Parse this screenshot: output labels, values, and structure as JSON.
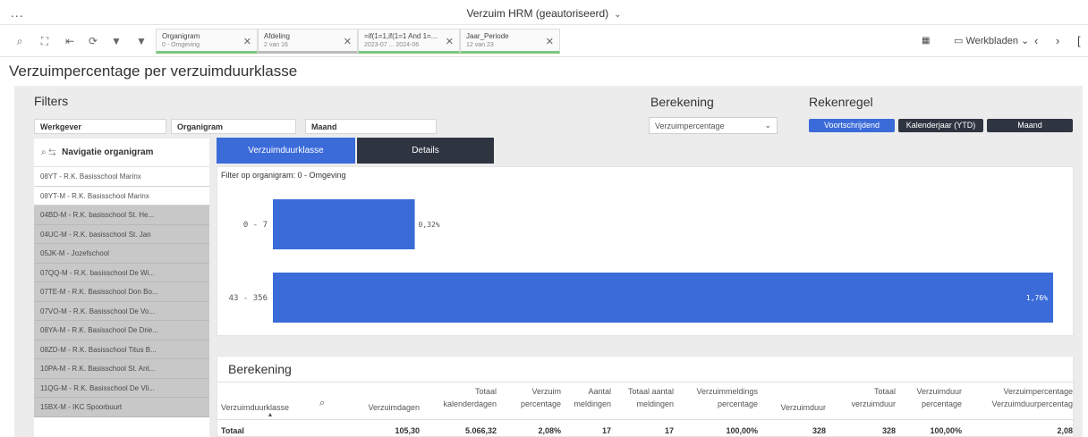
{
  "app": {
    "title": "Verzuim HRM (geautoriseerd)",
    "menu_dots": "..."
  },
  "toolbar": {
    "chips": [
      {
        "title": "Organigram",
        "sub": "0 - Omgeving"
      },
      {
        "title": "Afdeling",
        "sub": "2 van 16"
      },
      {
        "title": "=if(1=1,if(1=1 And 1=...",
        "sub": "2023-07 ... 2024-06"
      },
      {
        "title": "Jaar_Periode",
        "sub": "12 van 23"
      }
    ],
    "sheets_label": "Werkbladen"
  },
  "page_title": "Verzuimpercentage per verzuimduurklasse",
  "filters": {
    "heading": "Filters",
    "fields": [
      "Werkgever",
      "Organigram",
      "Maand"
    ]
  },
  "berekening": {
    "heading": "Berekening",
    "selected": "Verzuimpercentage"
  },
  "rekenregel": {
    "heading": "Rekenregel",
    "buttons": [
      "Voortschrijdend",
      "Kalenderjaar (YTD)",
      "Maand"
    ]
  },
  "nav": {
    "title": "Navigatie organigram",
    "items": [
      "08YT - R.K. Basisschool Marinx",
      "08YT-M - R.K. Basisschool Marinx",
      "04BD-M - R.K. basisschool St. He...",
      "04UC-M - R.K. basisschool St. Jan",
      "05JK-M - Jozefschool",
      "07QQ-M - R.K. basisschool De Wi...",
      "07TE-M - R.K. Basisschool Don Bo...",
      "07VO-M - R.K. Basisschool De Vo...",
      "08YA-M - R.K. Basisschool De Drie...",
      "08ZD-M - R.K. Basisschool Titus B...",
      "10PA-M - R.K. Basisschool St. Ant...",
      "11QG-M - R.K. Basisschool De Vli...",
      "15BX-M - IKC Spoorbuurt"
    ]
  },
  "tabs": [
    "Verzuimduurklasse",
    "Details"
  ],
  "chart_filter_label": "Filter op organigram: 0 - Omgeving",
  "chart_data": {
    "type": "bar",
    "orientation": "horizontal",
    "categories": [
      "0 - 7",
      "43 - 356"
    ],
    "values": [
      0.32,
      1.76
    ],
    "value_labels": [
      "0,32%",
      "1,76%"
    ],
    "xlim": [
      0,
      1.76
    ],
    "grid": false,
    "color": "#3a6bd9"
  },
  "table": {
    "title": "Berekening",
    "headers": [
      [
        "Verzuimduurklasse"
      ],
      [
        "Verzuimdagen"
      ],
      [
        "Totaal",
        "kalenderdagen"
      ],
      [
        "Verzuim",
        "percentage"
      ],
      [
        "Aantal",
        "meldingen"
      ],
      [
        "Totaal aantal",
        "meldingen"
      ],
      [
        "Verzuimmeldings",
        "percentage"
      ],
      [
        "Verzuimduur"
      ],
      [
        "Totaal",
        "verzuimduur"
      ],
      [
        "Verzuimduur",
        "percentage"
      ],
      [
        "Verzuimpercentage",
        "Verzuimduurpercentag"
      ]
    ],
    "total_row": [
      "Totaal",
      "105,30",
      "5.066,32",
      "2,08%",
      "17",
      "17",
      "100,00%",
      "328",
      "328",
      "100,00%",
      "2,08"
    ]
  },
  "colors": {
    "accent": "#3a6bd9",
    "dark": "#2e3440",
    "chip_green": "#7bc67e"
  }
}
